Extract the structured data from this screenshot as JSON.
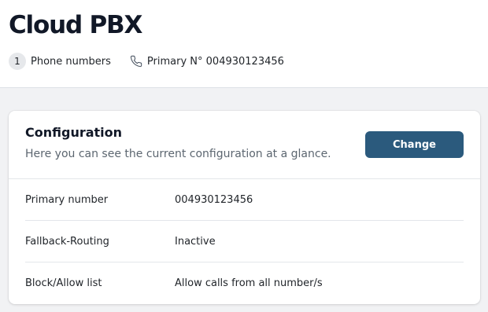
{
  "header": {
    "title": "Cloud PBX",
    "phone_count": "1",
    "phone_numbers_label": "Phone numbers",
    "primary_label": "Primary N° 004930123456"
  },
  "icons": {
    "phone": "phone-icon"
  },
  "config": {
    "title": "Configuration",
    "subtitle": "Here you can see the current configuration at a glance.",
    "change_label": "Change",
    "rows": [
      {
        "label": "Primary number",
        "value": "004930123456"
      },
      {
        "label": "Fallback-Routing",
        "value": "Inactive"
      },
      {
        "label": "Block/Allow list",
        "value": "Allow calls from all number/s"
      }
    ]
  },
  "colors": {
    "accent": "#2b5a7d",
    "page_background": "#f1f2f4"
  }
}
